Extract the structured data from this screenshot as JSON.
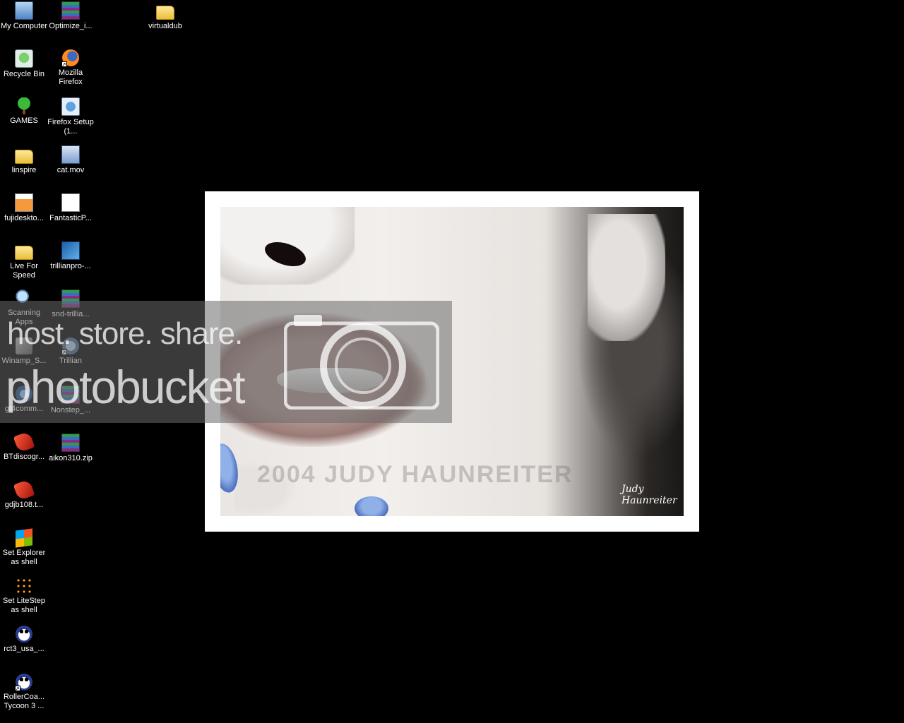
{
  "desktop": {
    "background_color": "#000000",
    "icons": [
      {
        "name": "my-computer",
        "label": "My Computer",
        "icon": "my-computer-icon",
        "shortcut": false
      },
      {
        "name": "recycle-bin",
        "label": "Recycle Bin",
        "icon": "recycle-bin-icon",
        "shortcut": false
      },
      {
        "name": "games",
        "label": "GAMES",
        "icon": "tree-folder-icon",
        "shortcut": false
      },
      {
        "name": "linspire",
        "label": "linspire",
        "icon": "folder-icon",
        "shortcut": false
      },
      {
        "name": "fujidesktop",
        "label": "fujidesktо...",
        "icon": "image-file-icon",
        "shortcut": false
      },
      {
        "name": "live-for-speed",
        "label": "Live For Speed",
        "icon": "folder-icon",
        "shortcut": false
      },
      {
        "name": "scanning-apps",
        "label": "Scanning Apps",
        "icon": "magnifier-icon",
        "shortcut": false
      },
      {
        "name": "winamp",
        "label": "Winamp_S...",
        "icon": "winamp-icon",
        "shortcut": false
      },
      {
        "name": "gt4comm",
        "label": "gt4comm...",
        "icon": "gt4-icon",
        "shortcut": false
      },
      {
        "name": "btdiscog",
        "label": "BTdiscogr...",
        "icon": "bittorrent-icon",
        "shortcut": false
      },
      {
        "name": "gdjb108",
        "label": "gdjb108.t...",
        "icon": "bittorrent-icon",
        "shortcut": false
      },
      {
        "name": "set-explorer-shell",
        "label": "Set Explorer as shell",
        "icon": "windows-icon",
        "shortcut": false
      },
      {
        "name": "set-litestep-shell",
        "label": "Set LiteStep as shell",
        "icon": "litestep-icon",
        "shortcut": false
      },
      {
        "name": "rct3-usa",
        "label": "rct3_usa_...",
        "icon": "panda-icon",
        "shortcut": false
      },
      {
        "name": "rollercoaster-tycoon-3",
        "label": "RollerCoa... Tycoon 3 ...",
        "icon": "panda-icon",
        "shortcut": true
      },
      {
        "name": "optimize",
        "label": "Optimize_i...",
        "icon": "archive-icon",
        "shortcut": false
      },
      {
        "name": "mozilla-firefox",
        "label": "Mozilla Firefox",
        "icon": "firefox-icon",
        "shortcut": true
      },
      {
        "name": "firefox-setup",
        "label": "Firefox Setup (1...",
        "icon": "installer-icon",
        "shortcut": false
      },
      {
        "name": "cat-mov",
        "label": "cat.mov",
        "icon": "movie-file-icon",
        "shortcut": false
      },
      {
        "name": "fantasticp",
        "label": "FantasticP...",
        "icon": "document-icon",
        "shortcut": false
      },
      {
        "name": "trillianpro",
        "label": "trillianpro-...",
        "icon": "setup-app-icon",
        "shortcut": false
      },
      {
        "name": "snd-trillian",
        "label": "snd-trillia...",
        "icon": "archive-icon",
        "shortcut": false
      },
      {
        "name": "trillian",
        "label": "Trillian",
        "icon": "trillian-icon",
        "shortcut": true
      },
      {
        "name": "nonstep",
        "label": "Nonstep_...",
        "icon": "archive-icon",
        "shortcut": false
      },
      {
        "name": "aikon310",
        "label": "aikon310.zip",
        "icon": "archive-icon",
        "shortcut": false
      },
      {
        "name": "virtualdub",
        "label": "virtualdub",
        "icon": "folder-icon",
        "shortcut": false
      }
    ]
  },
  "wallpaper": {
    "frame_color": "#ffffff",
    "watermark_text": "2004 JUDY HAUNREITER",
    "signature_text": "Judy Haunreiter",
    "nail_color": "#5a7fd0"
  },
  "overlay": {
    "tagline": "host. store. share.",
    "brand": "photobucket",
    "icon": "camera-icon"
  }
}
